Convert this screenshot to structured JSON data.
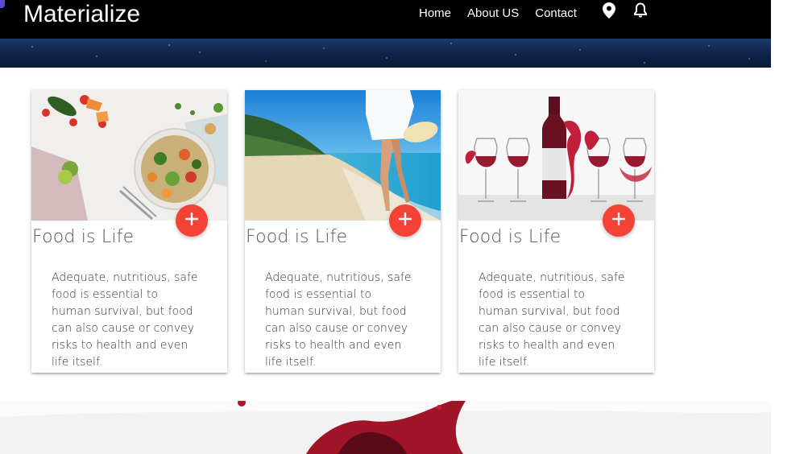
{
  "navbar": {
    "brand": "Materialize",
    "links": [
      {
        "label": "Home"
      },
      {
        "label": "About US"
      },
      {
        "label": "Contact"
      }
    ],
    "icons": [
      "location-pin-icon",
      "bell-icon"
    ]
  },
  "colors": {
    "navbar_bg": "#000000",
    "fab": "#f44336",
    "title_text": "#555555"
  },
  "cards": [
    {
      "image": "food-bowl-photo",
      "title": "Food is Life",
      "text": "Adequate, nutritious, safe food is essential to human survival, but food can also cause or convey risks to health and even life itself."
    },
    {
      "image": "beach-photo",
      "title": "Food is Life",
      "text": "Adequate, nutritious, safe food is essential to human survival, but food can also cause or convey risks to health and even life itself."
    },
    {
      "image": "wine-photo",
      "title": "Food is Life",
      "text": "Adequate, nutritious, safe food is essential to human survival, but food can also cause or convey risks to health and even life itself."
    }
  ],
  "fab_icon": "plus-icon"
}
